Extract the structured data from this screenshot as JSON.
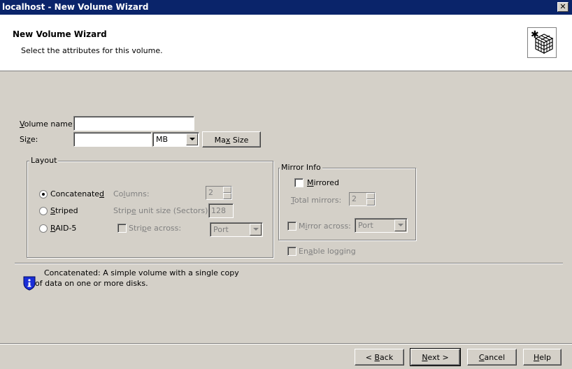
{
  "window": {
    "title": "localhost - New Volume Wizard",
    "close_glyph": "✕"
  },
  "header": {
    "title": "New Volume Wizard",
    "subtitle": "Select the attributes for this volume.",
    "icon": "wizard-cube-icon"
  },
  "fields": {
    "volume_name_label": "Volume name:",
    "volume_name_value": "",
    "size_label": "Size:",
    "size_value": "",
    "size_unit": "MB",
    "max_size_button": "Max Size"
  },
  "layout": {
    "title": "Layout",
    "options": [
      "Concatenated",
      "Striped",
      "RAID-5"
    ],
    "selected": "Concatenated",
    "columns_label": "Columns:",
    "columns_value": "2",
    "stripe_unit_label": "Stripe unit size (Sectors):",
    "stripe_unit_value": "128",
    "stripe_across_label": "Stripe across:",
    "stripe_across_value": "Port"
  },
  "mirror": {
    "title": "Mirror Info",
    "mirrored_label": "Mirrored",
    "total_mirrors_label": "Total mirrors:",
    "total_mirrors_value": "2",
    "mirror_across_label": "Mirror across:",
    "mirror_across_value": "Port"
  },
  "logging": {
    "label": "Enable logging"
  },
  "info": {
    "line1": "Concatenated: A simple volume with a single copy",
    "line2": "of data on one or more disks.",
    "icon": "info-icon"
  },
  "buttons": {
    "back": "< Back",
    "next": "Next >",
    "cancel": "Cancel",
    "help": "Help"
  },
  "colors": {
    "titlebar": "#0a246a",
    "dialog": "#d4d0c8",
    "info_icon": "#1a2ed8"
  }
}
